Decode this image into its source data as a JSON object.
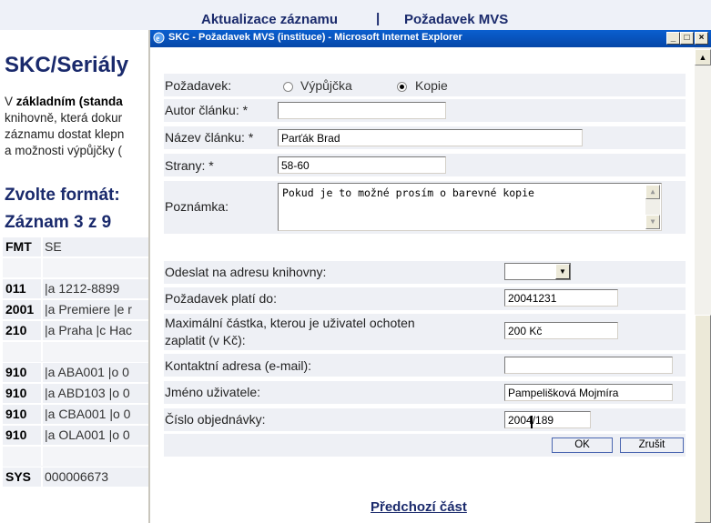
{
  "background_page": {
    "top_links": [
      "Aktualizace záznamu",
      "Požadavek MVS"
    ],
    "separator": "|",
    "title": "SKC/Seriály",
    "intro_lines": [
      {
        "bold_prefix": "V ",
        "bold": "základním (standa",
        "rest": ""
      },
      {
        "bold_prefix": "",
        "bold": "",
        "rest": "knihovně, která dokur"
      },
      {
        "bold_prefix": "",
        "bold": "",
        "rest": "záznamu dostat klepn"
      },
      {
        "bold_prefix": "",
        "bold": "",
        "rest": "a možnosti výpůjčky ("
      }
    ],
    "format_heading": "Zvolte formát:",
    "record_heading": "Záznam 3 z 9",
    "record_rows": [
      {
        "k": "FMT",
        "v": "SE"
      },
      {
        "k": "",
        "v": ""
      },
      {
        "k": "011",
        "v": "|a 1212-8899"
      },
      {
        "k": "2001",
        "v": "|a Premiere |e r"
      },
      {
        "k": "210",
        "v": "|a Praha |c Hac"
      },
      {
        "k": "",
        "v": ""
      },
      {
        "k": "910",
        "v": "|a ABA001 |o 0"
      },
      {
        "k": "910",
        "v": "|a ABD103 |o 0"
      },
      {
        "k": "910",
        "v": "|a CBA001 |o 0"
      },
      {
        "k": "910",
        "v": "|a OLA001 |o 0"
      },
      {
        "k": "",
        "v": ""
      },
      {
        "k": "SYS",
        "v": "000006673"
      }
    ]
  },
  "popup": {
    "title": "SKC - Požadavek MVS (instituce) - Microsoft Internet Explorer",
    "window_buttons": {
      "minimize": "_",
      "maximize": "□",
      "close": "×"
    },
    "form": {
      "request_label": "Požadavek:",
      "request_options": [
        {
          "label": "Výpůjčka",
          "selected": false
        },
        {
          "label": "Kopie",
          "selected": true
        }
      ],
      "author_label": "Autor článku: *",
      "author_value": "",
      "article_title_label": "Název článku: *",
      "article_title_value": "Parťák Brad",
      "pages_label": "Strany: *",
      "pages_value": "58-60",
      "note_label": "Poznámka:",
      "note_value": "Pokud je to možné prosím o barevné kopie",
      "send_to_label": "Odeslat na adresu knihovny:",
      "send_to_value": "",
      "valid_until_label": "Požadavek platí do:",
      "valid_until_value": "20041231",
      "max_amount_label_line1": "Maximální částka, kterou je uživatel ochoten",
      "max_amount_label_line2": "zaplatit (v Kč):",
      "max_amount_value": "200 Kč",
      "contact_label": "Kontaktní adresa (e-mail):",
      "contact_value": "",
      "user_name_label": "Jméno uživatele:",
      "user_name_value": "Pampelišková Mojmíra",
      "order_number_label": "Číslo objednávky:",
      "order_number_value": "2004/189",
      "ok_label": "OK",
      "cancel_label": "Zrušit"
    },
    "footer_link": "Předchozí část"
  }
}
